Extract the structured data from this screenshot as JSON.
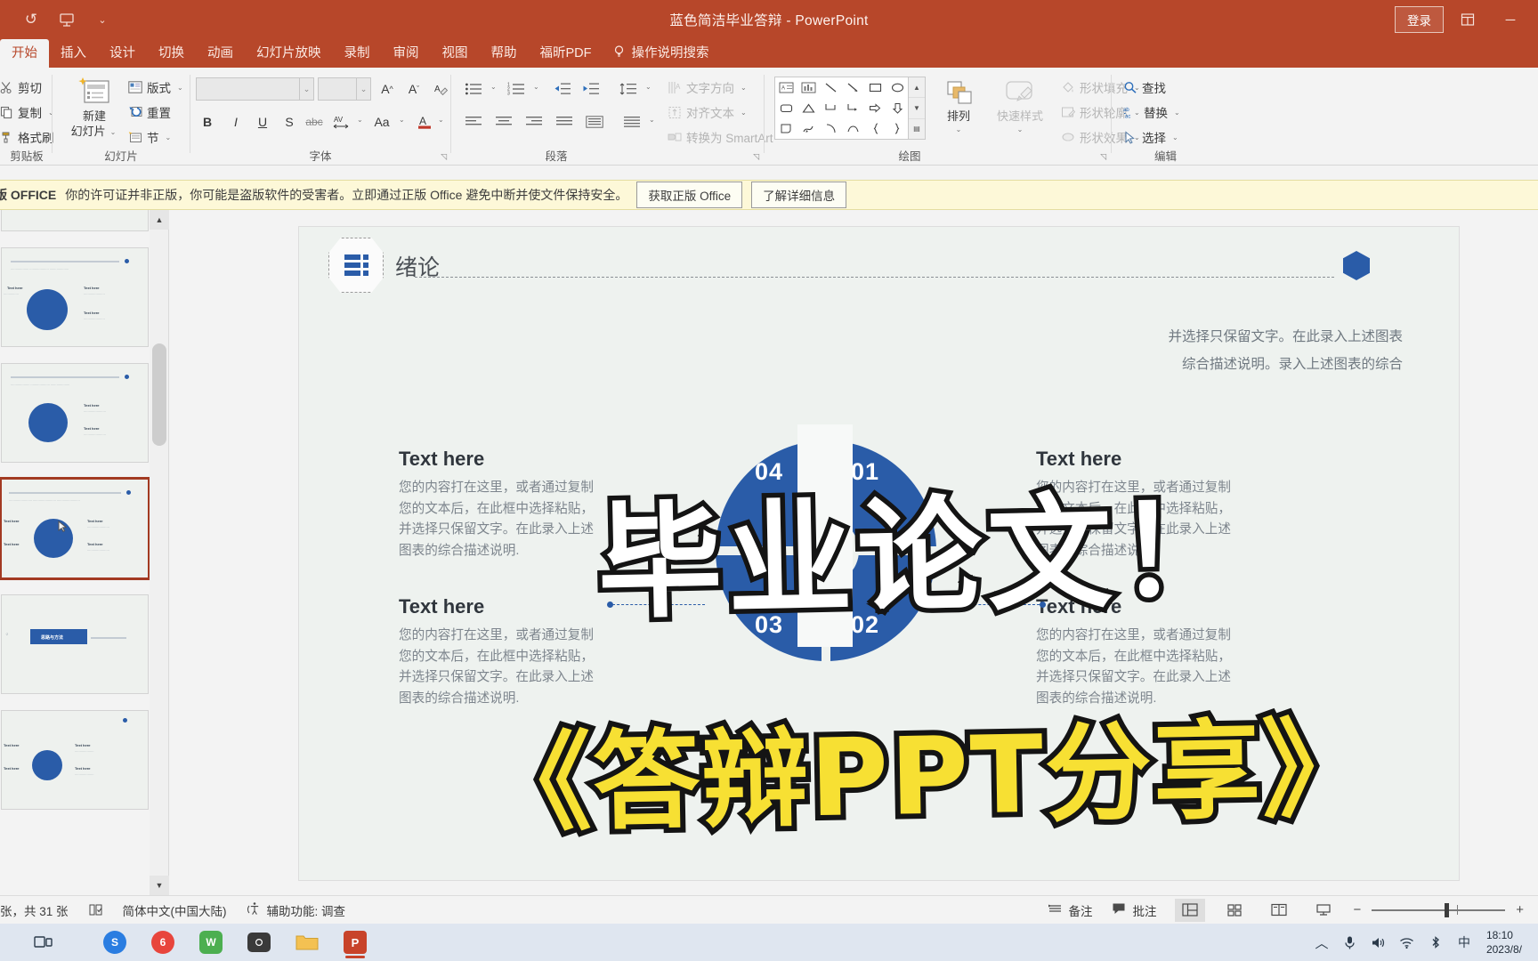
{
  "app": {
    "title": "蓝色简洁毕业答辩  -  PowerPoint",
    "signin_label": "登录",
    "quick_access": [
      "undo-icon",
      "present-icon",
      "customize-qat-icon"
    ],
    "window_buttons": [
      "ribbon-display-options",
      "minimize"
    ]
  },
  "ribbon": {
    "tabs": [
      "开始",
      "插入",
      "设计",
      "切换",
      "动画",
      "幻灯片放映",
      "录制",
      "审阅",
      "视图",
      "帮助",
      "福昕PDF"
    ],
    "active_tab": "开始",
    "tell_me": "操作说明搜索",
    "groups": [
      {
        "name": "剪贴板",
        "label": "剪贴板",
        "items": [
          "剪切",
          "复制",
          "格式刷"
        ]
      },
      {
        "name": "幻灯片",
        "label": "幻灯片",
        "items": [
          "新建幻灯片",
          "版式",
          "重置",
          "节"
        ]
      },
      {
        "name": "字体",
        "label": "字体",
        "font_name": "",
        "font_size": "",
        "items": [
          "B",
          "I",
          "U",
          "S",
          "abc",
          "AV",
          "Aa",
          "A"
        ]
      },
      {
        "name": "段落",
        "label": "段落",
        "items": [
          "文字方向",
          "对齐文本",
          "转换为 SmartArt"
        ]
      },
      {
        "name": "绘图",
        "label": "绘图",
        "items": [
          "排列",
          "快速样式",
          "形状填充",
          "形状轮廓",
          "形状效果"
        ]
      },
      {
        "name": "编辑",
        "label": "编辑",
        "items": [
          "查找",
          "替换",
          "选择"
        ]
      }
    ]
  },
  "banner": {
    "prefix": "版 OFFICE",
    "message": "你的许可证并非正版，你可能是盗版软件的受害者。立即通过正版 Office 避免中断并使文件保持安全。",
    "buttons": [
      "获取正版 Office",
      "了解详细信息"
    ]
  },
  "slide": {
    "section_title": "绪论",
    "lead_text_line1": "并选择只保留文字。在此录入上述图表",
    "lead_text_line2": "综合描述说明。录入上述图表的综合",
    "quadrants": [
      {
        "position": "top-left",
        "title": "Text here",
        "body": "您的内容打在这里，或者通过复制您的文本后，在此框中选择粘贴，并选择只保留文字。在此录入上述图表的综合描述说明."
      },
      {
        "position": "top-right",
        "title": "Text here",
        "body": "您的内容打在这里，或者通过复制您的文本后，在此框中选择粘贴，并选择只保留文字。在此录入上述图表的综合描述说明."
      },
      {
        "position": "bottom-left",
        "title": "Text here",
        "body": "您的内容打在这里，或者通过复制您的文本后，在此框中选择粘贴，并选择只保留文字。在此录入上述图表的综合描述说明."
      },
      {
        "position": "bottom-right",
        "title": "Text here",
        "body": "您的内容打在这里，或者通过复制您的文本后，在此框中选择粘贴，并选择只保留文字。在此录入上述图表的综合描述说明."
      }
    ],
    "donut_numbers": [
      "01",
      "02",
      "03",
      "04"
    ],
    "accent_color": "#2a5ca8"
  },
  "overlay": {
    "line1": "毕业论文！",
    "line2": "《答辩PPT分享》",
    "line1_color": "#ffffff",
    "line2_color": "#f7e033",
    "stroke_color": "#141414"
  },
  "status": {
    "slide_count": "张，共 31 张",
    "language": "简体中文(中国大陆)",
    "accessibility": "辅助功能: 调查",
    "notes": "备注",
    "comments": "批注",
    "views": [
      "normal-view",
      "slide-sorter-view",
      "reading-view",
      "slideshow-view"
    ],
    "zoom_minus": "−",
    "zoom_plus": "+"
  },
  "taskbar": {
    "items": [
      "task-view",
      "wps-icon",
      "app-red-icon",
      "wechat-icon",
      "camera-icon",
      "folder-icon",
      "powerpoint-icon"
    ],
    "tray": [
      "show-hidden-icons",
      "microphone-icon",
      "volume-icon",
      "network-icon",
      "bluetooth-icon",
      "ime-icon"
    ],
    "time": "18:10",
    "date": "2023/8/"
  }
}
